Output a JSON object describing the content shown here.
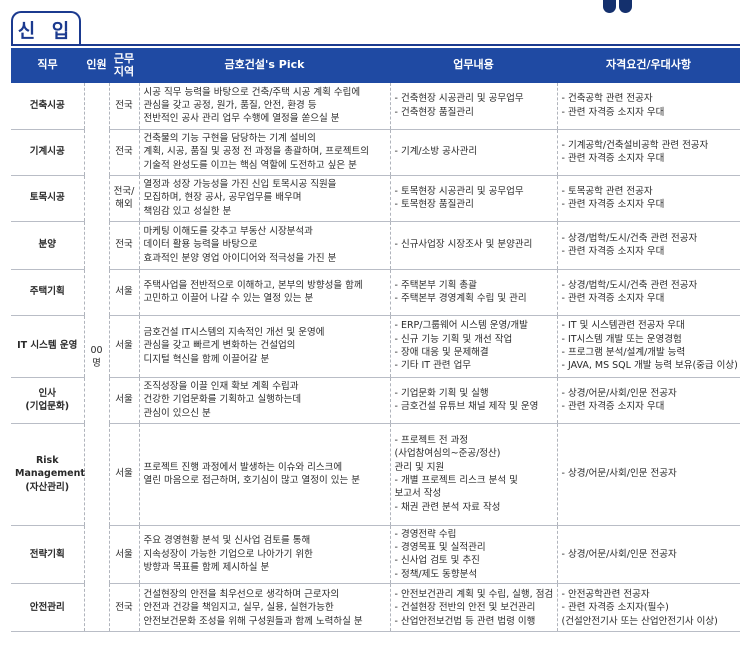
{
  "header": {
    "title": "신 입"
  },
  "table": {
    "columns": [
      "직무",
      "인원",
      "근무\n지역",
      "금호건설's Pick",
      "업무내용",
      "자격요건/우대사항"
    ],
    "headcount": "00명",
    "rows": [
      {
        "job": [
          "건축시공"
        ],
        "location": [
          "전국"
        ],
        "pick": [
          "시공 직무 능력을 바탕으로 건축/주택 시공 계획 수립에",
          "관심을 갖고 공정, 원가, 품질, 안전, 환경 등",
          "전반적인 공사 관리 업무 수행에 열정을 쏟으실 분"
        ],
        "duties": [
          "- 건축현장 시공관리 및 공무업무",
          "- 건축현장 품질관리"
        ],
        "qualifications": [
          "- 건축공학 관련 전공자",
          "- 관련 자격증 소지자 우대"
        ]
      },
      {
        "job": [
          "기계시공"
        ],
        "location": [
          "전국"
        ],
        "pick": [
          "건축물의 기능 구현을 담당하는 기계 설비의",
          "계획, 시공, 품질 및 공정 전 과정을 총괄하며, 프로젝트의",
          "기술적 완성도를 이끄는 핵심 역할에 도전하고 싶은 분"
        ],
        "duties": [
          "- 기계/소방 공사관리"
        ],
        "qualifications": [
          "- 기계공학/건축설비공학 관련 전공자",
          "- 관련 자격증 소지자 우대"
        ]
      },
      {
        "job": [
          "토목시공"
        ],
        "location": [
          "전국/",
          "해외"
        ],
        "pick": [
          "열정과 성장 가능성을 가진 신입 토목시공 직원을",
          "모집하며, 현장 공사, 공무업무를 배우며",
          "책임감 있고 성실한 분"
        ],
        "duties": [
          "- 토목현장 시공관리 및 공무업무",
          "- 토목현장 품질관리"
        ],
        "qualifications": [
          "- 토목공학 관련 전공자",
          "- 관련 자격증 소지자 우대"
        ]
      },
      {
        "job": [
          "분양"
        ],
        "location": [
          "전국"
        ],
        "pick": [
          "마케팅 이해도를 갖추고 부동산 시장분석과",
          "데이터 활용 능력을 바탕으로",
          "효과적인 분양 영업 아이디어와 적극성을 가진 분"
        ],
        "duties": [
          "- 신규사업장 시장조사 및 분양관리"
        ],
        "qualifications": [
          "- 상경/법학/도시/건축 관련 전공자",
          "- 관련 자격증 소지자 우대"
        ]
      },
      {
        "job": [
          "주택기획"
        ],
        "location": [
          "서울"
        ],
        "pick": [
          "주택사업을 전반적으로 이해하고, 본부의 방향성을 함께",
          "고민하고 이끌어 나갈 수 있는 열정 있는 분"
        ],
        "duties": [
          "- 주택본부 기획 총괄",
          "- 주택본부 경영계획 수립 및 관리"
        ],
        "qualifications": [
          "- 상경/법학/도시/건축 관련 전공자",
          "- 관련 자격증 소지자 우대"
        ]
      },
      {
        "job": [
          "IT 시스템 운영"
        ],
        "location": [
          "서울"
        ],
        "pick": [
          "금호건설 IT시스템의 지속적인 개선 및 운영에",
          "관심을 갖고 빠르게 변화하는 건설업의",
          "디지털 혁신을 함께 이끌어갈 분"
        ],
        "duties": [
          "- ERP/그룹웨어 시스템 운영/개발",
          "- 신규 기능 기획 및 개선 작업",
          "- 장애 대응 및 문제해결",
          "- 기타 IT 관련 업무"
        ],
        "qualifications": [
          "- IT 및 시스템관련 전공자 우대",
          "- IT시스템 개발 또는 운영경험",
          "- 프로그램 분석/설계/개발 능력",
          "- JAVA, MS SQL 개발 능력 보유(중급 이상)"
        ]
      },
      {
        "job": [
          "인사",
          "(기업문화)"
        ],
        "location": [
          "서울"
        ],
        "pick": [
          "조직성장을 이끌 인재 확보 계획 수립과",
          "건강한 기업문화를 기획하고 실행하는데",
          "관심이 있으신 분"
        ],
        "duties": [
          "- 기업문화 기획 및 실행",
          "- 금호건설 유튜브 채널 제작 및 운영"
        ],
        "qualifications": [
          "- 상경/어문/사회/인문 전공자",
          "- 관련 자격증 소지자 우대"
        ]
      },
      {
        "job": [
          "Risk",
          "Management",
          "(자산관리)"
        ],
        "location": [
          "서울"
        ],
        "pick": [
          "프로젝트 진행 과정에서 발생하는 이슈와 리스크에",
          "열린 마음으로 접근하며, 호기심이 많고 열정이 있는 분"
        ],
        "duties": [
          "- 프로젝트 전 과정",
          "  (사업참여심의~준공/정산)",
          "  관리 및 지원",
          "- 개별 프로젝트 리스크 분석 및",
          "  보고서 작성",
          "- 채권 관련 분석 자료 작성"
        ],
        "qualifications": [
          "- 상경/어문/사회/인문 전공자"
        ]
      },
      {
        "job": [
          "전략기획"
        ],
        "location": [
          "서울"
        ],
        "pick": [
          "주요 경영현황 분석 및 신사업 검토를 통해",
          "지속성장이 가능한 기업으로 나아가기 위한",
          "방향과 목표를 함께 제시하실 분"
        ],
        "duties": [
          "- 경영전략 수립",
          "- 경영목표 및 실적관리",
          "- 신사업 검토 및 추진",
          "- 정책/제도 동향분석"
        ],
        "qualifications": [
          "- 상경/어문/사회/인문 전공자"
        ]
      },
      {
        "job": [
          "안전관리"
        ],
        "location": [
          "전국"
        ],
        "pick": [
          "건설현장의 안전을 최우선으로 생각하며 근로자의",
          "안전과 건강을 책임지고, 실무, 실용, 실현가능한",
          "안전보건문화 조성을 위해 구성원들과 함께 노력하실 분"
        ],
        "duties": [
          "- 안전보건관리 계획 및 수립, 실행, 점검",
          "- 건설현장 전반의 안전 및 보건관리",
          "- 산업안전보건법 등 관련 법령 이행"
        ],
        "qualifications": [
          "- 안전공학관련 전공자",
          "- 관련 자격증 소지자(필수)",
          "  (건설안전기사 또는 산업안전기사 이상)"
        ]
      }
    ]
  }
}
